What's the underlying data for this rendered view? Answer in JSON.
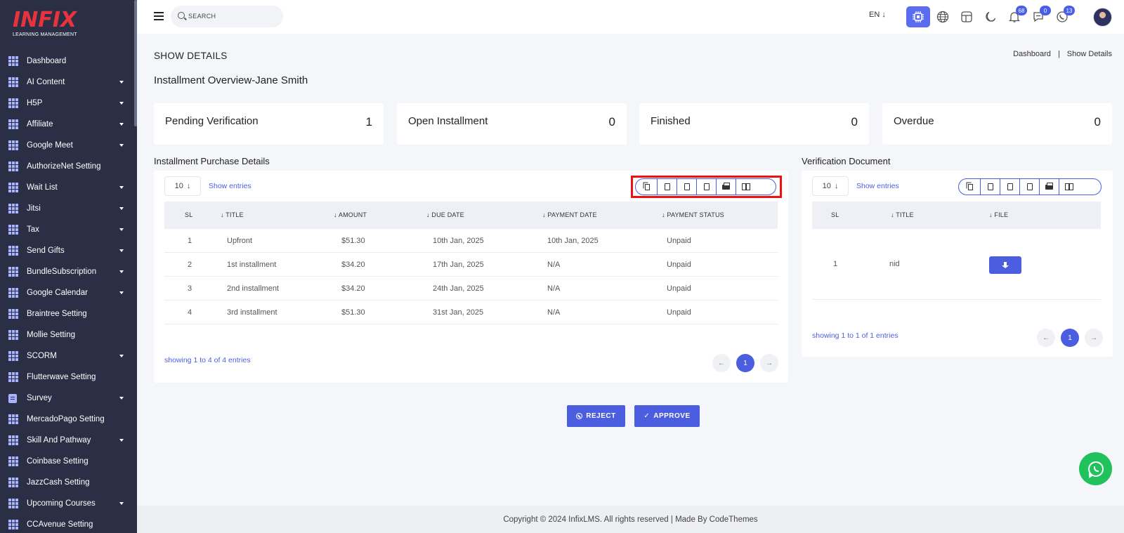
{
  "logo": {
    "main": "INFIX",
    "sub": "LEARNING MANAGEMENT"
  },
  "sidebar": {
    "items": [
      {
        "label": "Dashboard",
        "icon": "grid-icon",
        "caret": false
      },
      {
        "label": "AI Content",
        "icon": "grid-icon",
        "caret": true
      },
      {
        "label": "H5P",
        "icon": "grid-icon",
        "caret": true
      },
      {
        "label": "Affiliate",
        "icon": "grid-icon",
        "caret": true
      },
      {
        "label": "Google Meet",
        "icon": "grid-icon",
        "caret": true
      },
      {
        "label": "AuthorizeNet Setting",
        "icon": "grid-icon",
        "caret": false
      },
      {
        "label": "Wait List",
        "icon": "grid-icon",
        "caret": true
      },
      {
        "label": "Jitsi",
        "icon": "grid-icon",
        "caret": true
      },
      {
        "label": "Tax",
        "icon": "grid-icon",
        "caret": true
      },
      {
        "label": "Send Gifts",
        "icon": "grid-icon",
        "caret": true
      },
      {
        "label": "BundleSubscription",
        "icon": "grid-icon",
        "caret": true
      },
      {
        "label": "Google Calendar",
        "icon": "grid-icon",
        "caret": true
      },
      {
        "label": "Braintree Setting",
        "icon": "grid-icon",
        "caret": false
      },
      {
        "label": "Mollie Setting",
        "icon": "grid-icon",
        "caret": false
      },
      {
        "label": "SCORM",
        "icon": "grid-icon",
        "caret": true
      },
      {
        "label": "Flutterwave Setting",
        "icon": "grid-icon",
        "caret": false
      },
      {
        "label": "Survey",
        "icon": "document-icon",
        "caret": true
      },
      {
        "label": "MercadoPago Setting",
        "icon": "grid-icon",
        "caret": false
      },
      {
        "label": "Skill And Pathway",
        "icon": "grid-icon",
        "caret": true
      },
      {
        "label": "Coinbase Setting",
        "icon": "grid-icon",
        "caret": false
      },
      {
        "label": "JazzCash Setting",
        "icon": "grid-icon",
        "caret": false
      },
      {
        "label": "Upcoming Courses",
        "icon": "grid-icon",
        "caret": true
      },
      {
        "label": "CCAvenue Setting",
        "icon": "grid-icon",
        "caret": false
      }
    ]
  },
  "header": {
    "search_placeholder": "SEARCH",
    "language": "EN",
    "notifications_count": "68",
    "messages_count": "0",
    "whatsapp_count": "13"
  },
  "page": {
    "title": "SHOW DETAILS",
    "breadcrumb": [
      "Dashboard",
      "Show Details"
    ],
    "breadcrumb_sep": "|",
    "overview_title": "Installment Overview-Jane Smith"
  },
  "stats": [
    {
      "label": "Pending Verification",
      "value": "1"
    },
    {
      "label": "Open Installment",
      "value": "0"
    },
    {
      "label": "Finished",
      "value": "0"
    },
    {
      "label": "Overdue",
      "value": "0"
    }
  ],
  "purchase": {
    "title": "Installment Purchase Details",
    "page_size": "10",
    "show_entries": "Show entries",
    "columns": [
      "SL",
      "TITLE",
      "AMOUNT",
      "DUE DATE",
      "PAYMENT DATE",
      "PAYMENT STATUS"
    ],
    "rows": [
      [
        "1",
        "Upfront",
        "$51.30",
        "10th Jan, 2025",
        "10th Jan, 2025",
        "Unpaid"
      ],
      [
        "2",
        "1st installment",
        "$34.20",
        "17th Jan, 2025",
        "N/A",
        "Unpaid"
      ],
      [
        "3",
        "2nd installment",
        "$34.20",
        "24th Jan, 2025",
        "N/A",
        "Unpaid"
      ],
      [
        "4",
        "3rd installment",
        "$51.30",
        "31st Jan, 2025",
        "N/A",
        "Unpaid"
      ]
    ],
    "showing": "showing 1 to 4 of 4 entries",
    "current_page": "1"
  },
  "verification": {
    "title": "Verification Document",
    "page_size": "10",
    "show_entries": "Show entries",
    "columns": [
      "SL",
      "TITLE",
      "FILE"
    ],
    "rows": [
      [
        "1",
        "nid"
      ]
    ],
    "showing": "showing 1 to 1 of 1 entries",
    "current_page": "1"
  },
  "actions": {
    "reject": "REJECT",
    "approve": "APPROVE"
  },
  "footer": {
    "text": "Copyright © 2024 InfixLMS. All rights reserved | Made By CodeThemes"
  },
  "colors": {
    "accent": "#4b5ee0",
    "sidebar": "#2a2f45",
    "logo": "#e8333f",
    "whatsapp": "#21c15b",
    "highlight": "#ee1111"
  }
}
